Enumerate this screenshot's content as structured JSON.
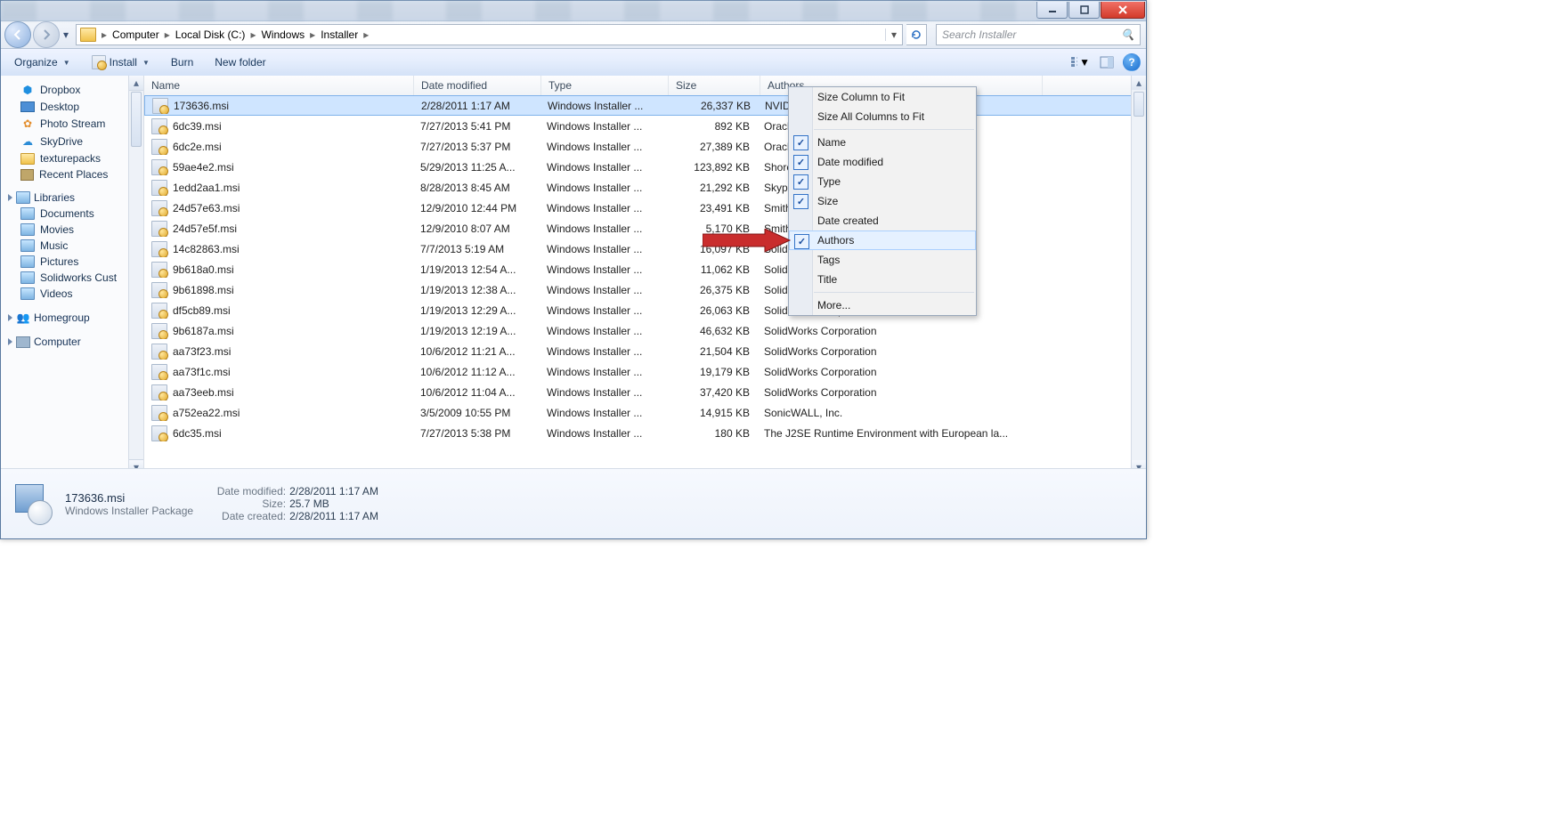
{
  "caption": {
    "min": "",
    "max": "",
    "close": ""
  },
  "breadcrumbs": [
    "Computer",
    "Local Disk (C:)",
    "Windows",
    "Installer"
  ],
  "search_placeholder": "Search Installer",
  "toolbar": {
    "organize": "Organize",
    "install": "Install",
    "burn": "Burn",
    "newfolder": "New folder"
  },
  "sidebar": {
    "fav_items": [
      "Dropbox",
      "Desktop",
      "Photo Stream",
      "SkyDrive",
      "texturepacks",
      "Recent Places"
    ],
    "libraries_hd": "Libraries",
    "libraries": [
      "Documents",
      "Movies",
      "Music",
      "Pictures",
      "Solidworks Cust",
      "Videos"
    ],
    "homegroup": "Homegroup",
    "computer": "Computer"
  },
  "columns": {
    "name": "Name",
    "date": "Date modified",
    "type": "Type",
    "size": "Size",
    "authors": "Authors"
  },
  "rows": [
    {
      "n": "173636.msi",
      "d": "2/28/2011 1:17 AM",
      "t": "Windows Installer ...",
      "s": "26,337 KB",
      "a": "NVIDIA Corp",
      "sel": true
    },
    {
      "n": "6dc39.msi",
      "d": "7/27/2013 5:41 PM",
      "t": "Windows Installer ...",
      "s": "892 KB",
      "a": "Oracle"
    },
    {
      "n": "6dc2e.msi",
      "d": "7/27/2013 5:37 PM",
      "t": "Windows Installer ...",
      "s": "27,389 KB",
      "a": "Oracle"
    },
    {
      "n": "59ae4e2.msi",
      "d": "5/29/2013 11:25 A...",
      "t": "Windows Installer ...",
      "s": "123,892 KB",
      "a": "ShoreTel Sky"
    },
    {
      "n": "1edd2aa1.msi",
      "d": "8/28/2013 8:45 AM",
      "t": "Windows Installer ...",
      "s": "21,292 KB",
      "a": "Skype Techn"
    },
    {
      "n": "24d57e63.msi",
      "d": "12/9/2010 12:44 PM",
      "t": "Windows Installer ...",
      "s": "23,491 KB",
      "a": "Smith Micro"
    },
    {
      "n": "24d57e5f.msi",
      "d": "12/9/2010 8:07 AM",
      "t": "Windows Installer ...",
      "s": "5,170 KB",
      "a": "Smith Micro"
    },
    {
      "n": "14c82863.msi",
      "d": "7/7/2013 5:19 AM",
      "t": "Windows Installer ...",
      "s": "16,097 KB",
      "a": "SolidWorks C"
    },
    {
      "n": "9b618a0.msi",
      "d": "1/19/2013 12:54 A...",
      "t": "Windows Installer ...",
      "s": "11,062 KB",
      "a": "SolidWorks C"
    },
    {
      "n": "9b61898.msi",
      "d": "1/19/2013 12:38 A...",
      "t": "Windows Installer ...",
      "s": "26,375 KB",
      "a": "SolidWorks C"
    },
    {
      "n": "df5cb89.msi",
      "d": "1/19/2013 12:29 A...",
      "t": "Windows Installer ...",
      "s": "26,063 KB",
      "a": "SolidWorks Corporation"
    },
    {
      "n": "9b6187a.msi",
      "d": "1/19/2013 12:19 A...",
      "t": "Windows Installer ...",
      "s": "46,632 KB",
      "a": "SolidWorks Corporation"
    },
    {
      "n": "aa73f23.msi",
      "d": "10/6/2012 11:21 A...",
      "t": "Windows Installer ...",
      "s": "21,504 KB",
      "a": "SolidWorks Corporation"
    },
    {
      "n": "aa73f1c.msi",
      "d": "10/6/2012 11:12 A...",
      "t": "Windows Installer ...",
      "s": "19,179 KB",
      "a": "SolidWorks Corporation"
    },
    {
      "n": "aa73eeb.msi",
      "d": "10/6/2012 11:04 A...",
      "t": "Windows Installer ...",
      "s": "37,420 KB",
      "a": "SolidWorks Corporation"
    },
    {
      "n": "a752ea22.msi",
      "d": "3/5/2009 10:55 PM",
      "t": "Windows Installer ...",
      "s": "14,915 KB",
      "a": "SonicWALL, Inc."
    },
    {
      "n": "6dc35.msi",
      "d": "7/27/2013 5:38 PM",
      "t": "Windows Installer ...",
      "s": "180 KB",
      "a": "The J2SE Runtime Environment with European la..."
    }
  ],
  "ctx": {
    "fit": "Size Column to Fit",
    "fitall": "Size All Columns to Fit",
    "cols": [
      {
        "l": "Name",
        "c": true
      },
      {
        "l": "Date modified",
        "c": true
      },
      {
        "l": "Type",
        "c": true
      },
      {
        "l": "Size",
        "c": true
      },
      {
        "l": "Date created",
        "c": false
      },
      {
        "l": "Authors",
        "c": true
      },
      {
        "l": "Tags",
        "c": false
      },
      {
        "l": "Title",
        "c": false
      }
    ],
    "more": "More..."
  },
  "details": {
    "name": "173636.msi",
    "subtitle": "Windows Installer Package",
    "modified_l": "Date modified:",
    "modified": "2/28/2011 1:17 AM",
    "size_l": "Size:",
    "size": "25.7 MB",
    "created_l": "Date created:",
    "created": "2/28/2011 1:17 AM"
  }
}
